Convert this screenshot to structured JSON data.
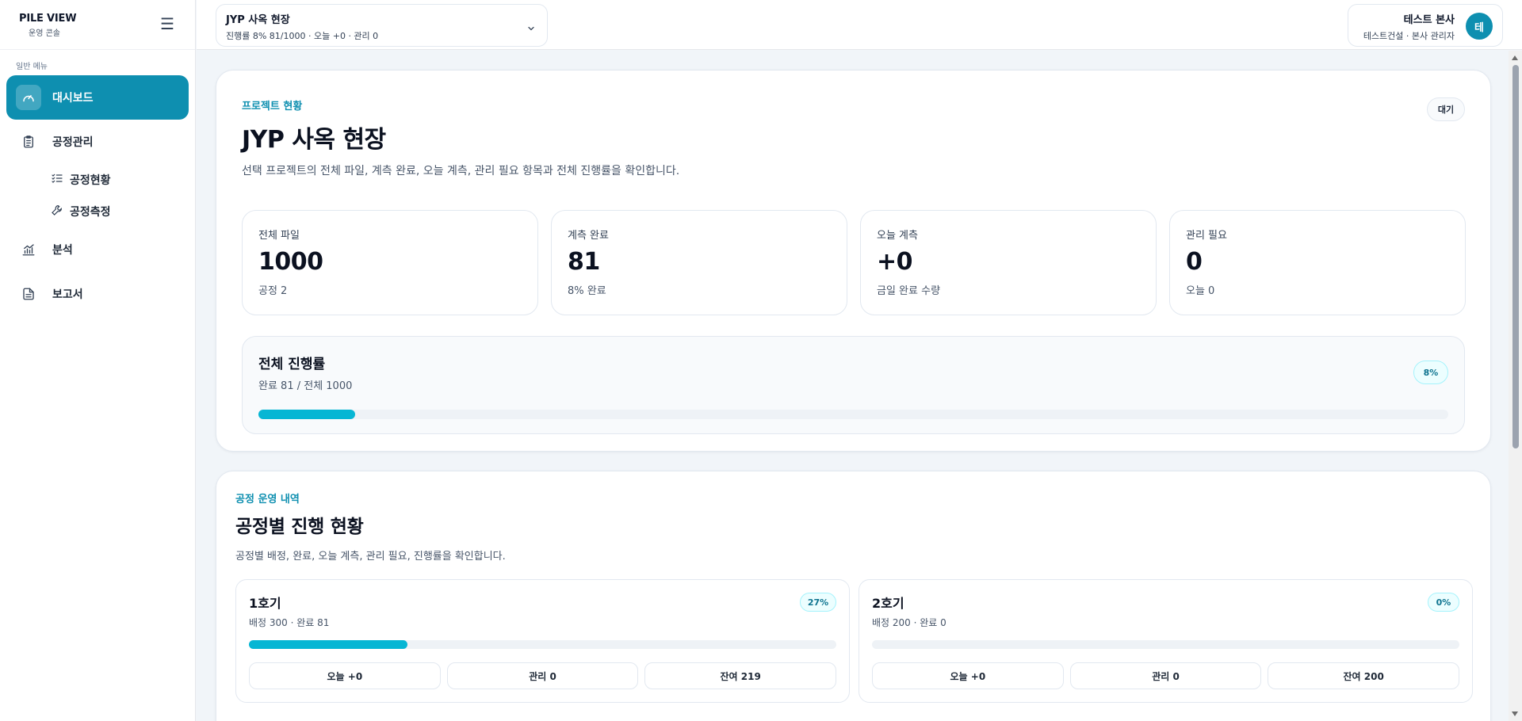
{
  "brand": {
    "title": "PILE VIEW",
    "subtitle": "운영 콘솔"
  },
  "sidebar": {
    "caption": "일반 메뉴",
    "items": [
      {
        "label": "대시보드",
        "icon": "gauge-icon",
        "active": true
      },
      {
        "label": "공정관리",
        "icon": "clipboard-icon"
      },
      {
        "label": "분석",
        "icon": "chart-icon"
      },
      {
        "label": "보고서",
        "icon": "document-icon"
      }
    ],
    "subitems": [
      {
        "label": "공정현황",
        "icon": "checklist-icon"
      },
      {
        "label": "공정측정",
        "icon": "wrench-icon"
      }
    ]
  },
  "topbar": {
    "project_title": "JYP 사옥 현장",
    "project_summary": "진행률 8% 81/1000 · 오늘 +0 · 관리 0",
    "user_name": "테스트 본사",
    "user_role": "테스트건설 · 본사 관리자",
    "avatar_initial": "테"
  },
  "overview": {
    "eyebrow": "프로젝트 현황",
    "title": "JYP 사옥 현장",
    "description": "선택 프로젝트의 전체 파일, 계측 완료, 오늘 계측, 관리 필요 항목과 전체 진행률을 확인합니다.",
    "status": "대기",
    "stats": [
      {
        "label": "전체 파일",
        "value": "1000",
        "sub": "공정 2"
      },
      {
        "label": "계측 완료",
        "value": "81",
        "sub": "8% 완료"
      },
      {
        "label": "오늘 계측",
        "value": "+0",
        "sub": "금일 완료 수량"
      },
      {
        "label": "관리 필요",
        "value": "0",
        "sub": "오늘 0"
      }
    ],
    "progress": {
      "title": "전체 진행률",
      "sub": "완료 81 / 전체 1000",
      "percent_label": "8%",
      "fraction": 0.081
    }
  },
  "processes": {
    "eyebrow": "공정 운영 내역",
    "title": "공정별 진행 현황",
    "description": "공정별 배정, 완료, 오늘 계측, 관리 필요, 진행률을 확인합니다.",
    "items": [
      {
        "name": "1호기",
        "summary": "배정 300 · 완료 81",
        "percent_label": "27%",
        "fraction": 0.27,
        "today": "오늘 +0",
        "manage": "관리 0",
        "remaining": "잔여 219"
      },
      {
        "name": "2호기",
        "summary": "배정 200 · 완료 0",
        "percent_label": "0%",
        "fraction": 0,
        "today": "오늘 +0",
        "manage": "관리 0",
        "remaining": "잔여 200"
      }
    ]
  },
  "colors": {
    "accent": "#0e8fb0",
    "progress": "#06b6d4",
    "background": "#f1f5f9"
  }
}
